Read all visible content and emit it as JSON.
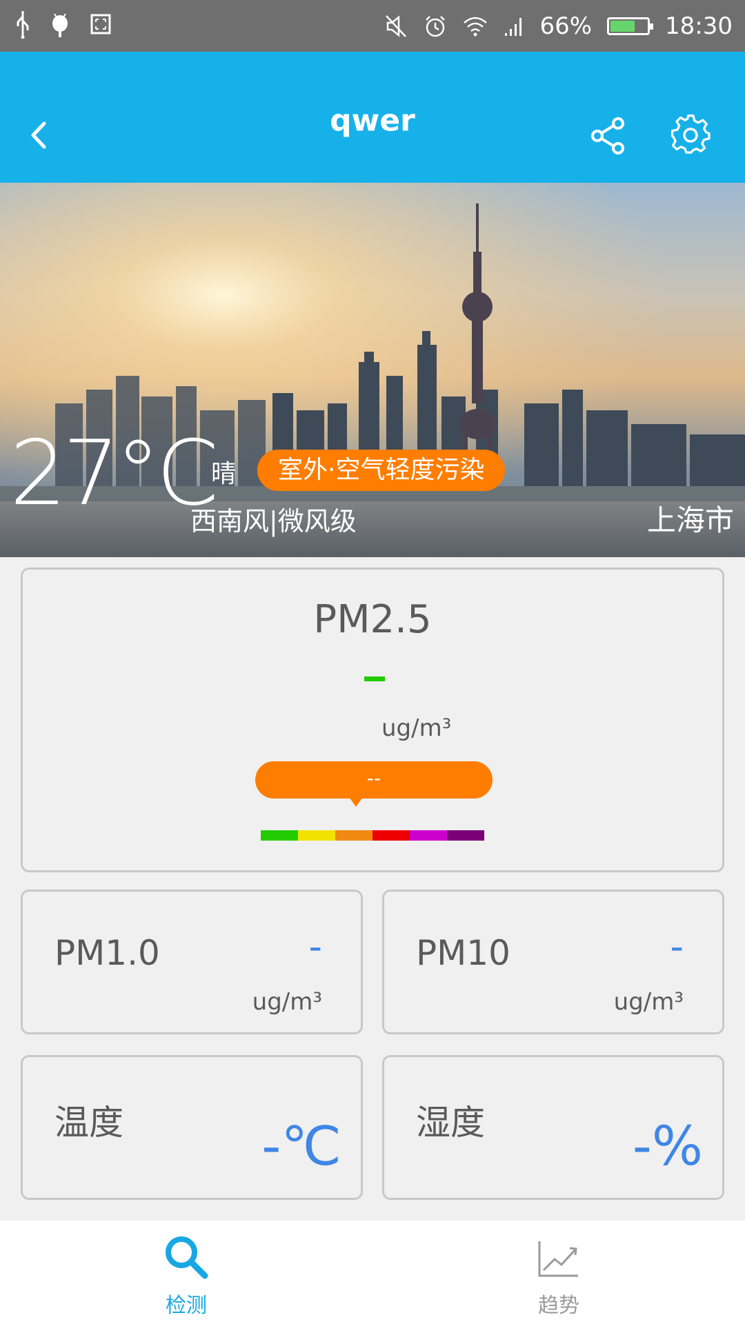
{
  "status_bar": {
    "battery_percent": "66%",
    "battery_level": 0.66,
    "time": "18:30",
    "left_icons": [
      "usb-icon",
      "android-debug-icon",
      "screenshot-icon"
    ],
    "right_icons": [
      "mute-icon",
      "alarm-icon",
      "wifi-icon",
      "signal-icon",
      "battery-icon"
    ]
  },
  "app_bar": {
    "title": "qwer",
    "back_icon": "chevron-left-icon",
    "share_icon": "share-icon",
    "settings_icon": "gear-icon"
  },
  "hero": {
    "temperature": "27°C",
    "condition": "晴",
    "air_badge": "室外·空气轻度污染",
    "wind": "西南风|微风级",
    "city": "上海市"
  },
  "pm25": {
    "label": "PM2.5",
    "unit": "ug/m³",
    "level_text": "--",
    "scale_colors": [
      "#22cc00",
      "#f2e200",
      "#f08a12",
      "#ee0000",
      "#cc00cc",
      "#7b0077"
    ]
  },
  "cards": {
    "pm1": {
      "label": "PM1.0",
      "value": "-",
      "unit": "ug/m³"
    },
    "pm10": {
      "label": "PM10",
      "value": "-",
      "unit": "ug/m³"
    },
    "temperature": {
      "label": "温度",
      "value": "-℃"
    },
    "humidity": {
      "label": "湿度",
      "value": "-%"
    }
  },
  "bottom_nav": {
    "items": [
      {
        "label": "检测",
        "icon": "search-icon",
        "active": true
      },
      {
        "label": "趋势",
        "icon": "trend-chart-icon",
        "active": false
      }
    ]
  },
  "colors": {
    "status_bar": "#6f6f6f",
    "app_bar": "#17b1ea",
    "accent_orange": "#ff7d00",
    "value_blue": "#3f86e6",
    "nav_active": "#17a8e3",
    "nav_inactive": "#9a9a9a"
  }
}
